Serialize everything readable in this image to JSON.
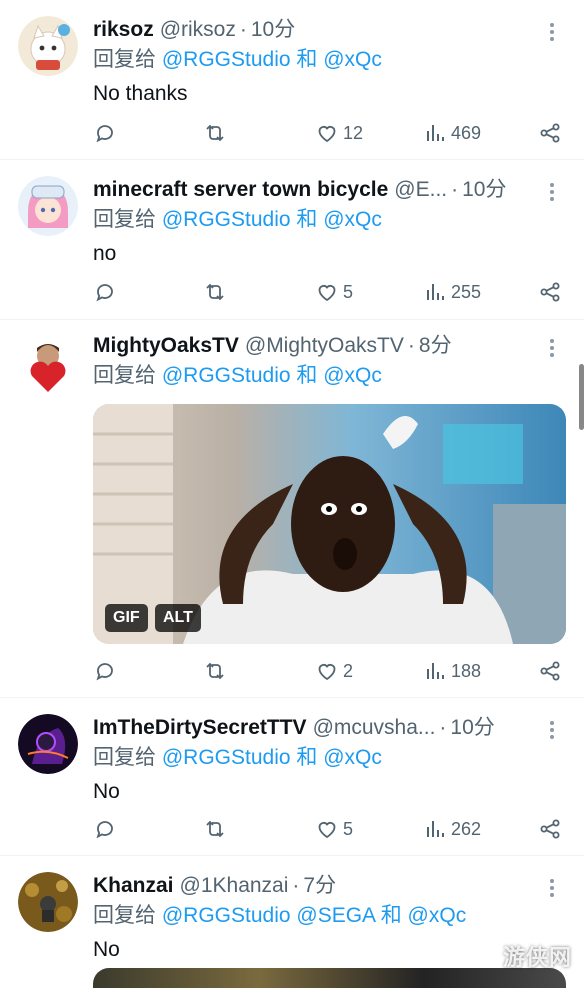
{
  "tweets": [
    {
      "display_name": "riksoz",
      "handle": "@riksoz",
      "time": "10分",
      "reply_prefix": "回复给",
      "reply_to": "@RGGStudio 和 @xQc",
      "text": "No thanks",
      "likes": "12",
      "views": "469",
      "avatar_icon": "cat-mascot-avatar"
    },
    {
      "display_name": "minecraft server town bicycle",
      "handle": "@E...",
      "time": "10分",
      "reply_prefix": "回复给",
      "reply_to": "@RGGStudio 和 @xQc",
      "text": "no",
      "likes": "5",
      "views": "255",
      "avatar_icon": "anime-girl-avatar"
    },
    {
      "display_name": "MightyOaksTV",
      "handle": "@MightyOaksTV",
      "time": "8分",
      "reply_prefix": "回复给",
      "reply_to": "@RGGStudio 和 @xQc",
      "text": "",
      "likes": "2",
      "views": "188",
      "media_badges": [
        "GIF",
        "ALT"
      ],
      "avatar_icon": "heart-character-avatar"
    },
    {
      "display_name": "ImTheDirtySecretTTV",
      "handle": "@mcuvsha...",
      "time": "10分",
      "reply_prefix": "回复给",
      "reply_to": "@RGGStudio 和 @xQc",
      "text": "No",
      "likes": "5",
      "views": "262",
      "avatar_icon": "purple-neon-avatar"
    },
    {
      "display_name": "Khanzai",
      "handle": "@1Khanzai",
      "time": "7分",
      "reply_prefix": "回复给",
      "reply_to": "@RGGStudio @SEGA 和 @xQc",
      "text": "No",
      "avatar_icon": "gold-bokeh-avatar"
    }
  ],
  "separator": "·",
  "watermark": "游侠网",
  "colors": {
    "mention": "#1d9bf0",
    "secondary_text": "#536471",
    "divider": "#eff3f4"
  }
}
